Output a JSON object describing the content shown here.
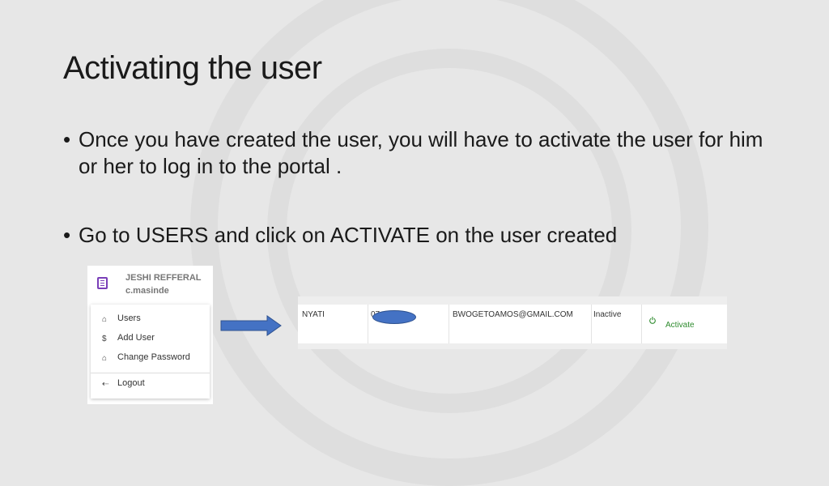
{
  "slide": {
    "title": "Activating the user",
    "bullets": [
      "Once you have created the user, you will have to activate the user for him or her to log in to the portal .",
      "Go to USERS and click on ACTIVATE on the user created"
    ],
    "bullet_glyph": "•"
  },
  "menu": {
    "header_name": "JESHI REFFERAL",
    "header_user": "c.masinde",
    "header_icon": "building-icon",
    "items": [
      {
        "label": "Users",
        "icon": "home-icon"
      },
      {
        "label": "Add User",
        "icon": "dollar-icon"
      },
      {
        "label": "Change Password",
        "icon": "home-icon"
      }
    ],
    "logout": {
      "label": "Logout",
      "icon": "logout-icon"
    }
  },
  "table_row": {
    "name": "NYATI",
    "phone_partial": "07",
    "email": "BWOGETOAMOS@GMAIL.COM",
    "status": "Inactive",
    "action_label": "Activate",
    "action_icon": "power-icon",
    "action_color": "#2e8b2e"
  },
  "colors": {
    "background": "#e7e7e7",
    "arrow": "#4472c4",
    "redaction": "#4472c4",
    "header_icon": "#7a3fb8"
  }
}
